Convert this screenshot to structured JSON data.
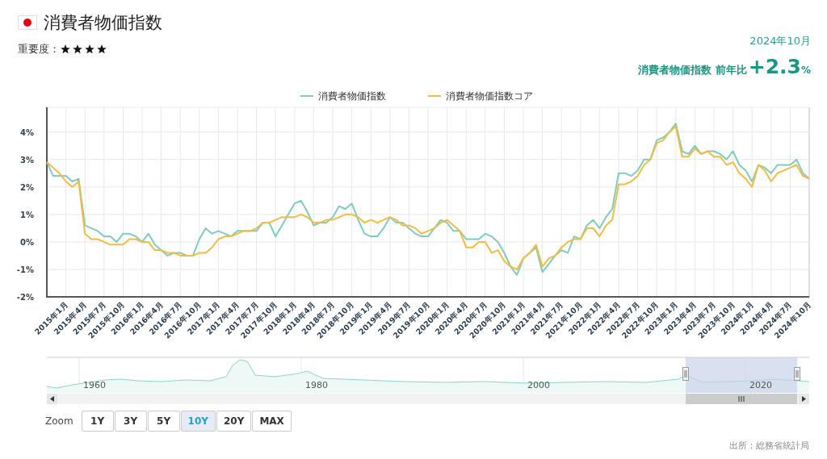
{
  "title": "消費者物価指数",
  "importance": {
    "label": "重要度：",
    "stars": 4
  },
  "latest": {
    "date": "2024年10月",
    "label": "消費者物価指数 前年比",
    "value": "+2.3",
    "unit": "%"
  },
  "chart_data": {
    "type": "line",
    "grid": true,
    "legend": true,
    "ylim": [
      -2,
      4.9
    ],
    "categories": [
      null,
      null,
      null,
      "2015年1月",
      null,
      null,
      "2015年4月",
      null,
      null,
      "2015年7月",
      null,
      null,
      "2015年10月",
      null,
      null,
      "2016年1月",
      null,
      null,
      "2016年4月",
      null,
      null,
      "2016年7月",
      null,
      null,
      "2016年10月",
      null,
      null,
      "2017年1月",
      null,
      null,
      "2017年4月",
      null,
      null,
      "2017年7月",
      null,
      null,
      "2017年10月",
      null,
      null,
      "2018年1月",
      null,
      null,
      "2018年4月",
      null,
      null,
      "2018年7月",
      null,
      null,
      "2018年10月",
      null,
      null,
      "2019年1月",
      null,
      null,
      "2019年4月",
      null,
      null,
      "2019年7月",
      null,
      null,
      "2019年10月",
      null,
      null,
      "2020年1月",
      null,
      null,
      "2020年4月",
      null,
      null,
      "2020年7月",
      null,
      null,
      "2020年10月",
      null,
      null,
      "2021年1月",
      null,
      null,
      "2021年4月",
      null,
      null,
      "2021年7月",
      null,
      null,
      "2021年10月",
      null,
      null,
      "2022年1月",
      null,
      null,
      "2022年4月",
      null,
      null,
      "2022年7月",
      null,
      null,
      "2022年10月",
      null,
      null,
      "2023年1月",
      null,
      null,
      "2023年4月",
      null,
      null,
      "2023年7月",
      null,
      null,
      "2023年10月",
      null,
      null,
      "2024年1月",
      null,
      null,
      "2024年4月",
      null,
      null,
      "2024年7月",
      null,
      null,
      "2024年10月"
    ],
    "yticks": [
      {
        "value": -2,
        "label": "-2%"
      },
      {
        "value": -1,
        "label": "-1%"
      },
      {
        "value": 0,
        "label": "0%"
      },
      {
        "value": 1,
        "label": "1%"
      },
      {
        "value": 2,
        "label": "2%"
      },
      {
        "value": 3,
        "label": "3%"
      },
      {
        "value": 4,
        "label": "4%"
      }
    ],
    "series": [
      {
        "name": "消費者物価指数",
        "color": "#7ccdbf",
        "values": [
          2.9,
          2.4,
          2.4,
          2.4,
          2.2,
          2.3,
          0.6,
          0.5,
          0.4,
          0.2,
          0.2,
          0.0,
          0.3,
          0.3,
          0.2,
          0.0,
          0.3,
          -0.1,
          -0.3,
          -0.5,
          -0.4,
          -0.4,
          -0.5,
          -0.5,
          0.1,
          0.5,
          0.3,
          0.4,
          0.3,
          0.2,
          0.4,
          0.4,
          0.4,
          0.4,
          0.7,
          0.7,
          0.2,
          0.6,
          1.0,
          1.4,
          1.5,
          1.1,
          0.6,
          0.7,
          0.7,
          0.9,
          1.3,
          1.2,
          1.4,
          0.8,
          0.3,
          0.2,
          0.2,
          0.5,
          0.9,
          0.7,
          0.7,
          0.5,
          0.3,
          0.2,
          0.2,
          0.5,
          0.8,
          0.7,
          0.4,
          0.4,
          0.1,
          0.1,
          0.1,
          0.3,
          0.2,
          0.0,
          -0.4,
          -0.9,
          -1.2,
          -0.6,
          -0.4,
          -0.2,
          -1.1,
          -0.8,
          -0.5,
          -0.3,
          -0.4,
          0.2,
          0.1,
          0.6,
          0.8,
          0.5,
          0.9,
          1.2,
          2.5,
          2.5,
          2.4,
          2.6,
          3.0,
          3.0,
          3.7,
          3.8,
          4.0,
          4.3,
          3.3,
          3.2,
          3.5,
          3.2,
          3.3,
          3.3,
          3.2,
          3.0,
          3.3,
          2.8,
          2.6,
          2.2,
          2.8,
          2.7,
          2.5,
          2.8,
          2.8,
          2.8,
          3.0,
          2.5,
          2.3
        ]
      },
      {
        "name": "消費者物価指数コア",
        "color": "#f4bc3e",
        "values": [
          2.9,
          2.7,
          2.5,
          2.2,
          2.0,
          2.2,
          0.3,
          0.1,
          0.1,
          0.0,
          -0.1,
          -0.1,
          -0.1,
          0.1,
          0.1,
          0.0,
          0.0,
          -0.3,
          -0.3,
          -0.4,
          -0.4,
          -0.5,
          -0.5,
          -0.5,
          -0.4,
          -0.4,
          -0.2,
          0.1,
          0.2,
          0.2,
          0.3,
          0.4,
          0.4,
          0.5,
          0.7,
          0.7,
          0.8,
          0.9,
          0.9,
          0.9,
          1.0,
          0.9,
          0.7,
          0.7,
          0.8,
          0.8,
          0.9,
          1.0,
          1.0,
          0.9,
          0.7,
          0.8,
          0.7,
          0.8,
          0.9,
          0.8,
          0.6,
          0.6,
          0.5,
          0.3,
          0.4,
          0.5,
          0.7,
          0.8,
          0.6,
          0.4,
          -0.2,
          -0.2,
          0.0,
          0.0,
          -0.4,
          -0.3,
          -0.7,
          -0.9,
          -1.0,
          -0.6,
          -0.4,
          -0.1,
          -0.9,
          -0.6,
          -0.5,
          -0.2,
          0.0,
          0.1,
          0.1,
          0.5,
          0.5,
          0.2,
          0.6,
          0.8,
          2.1,
          2.1,
          2.2,
          2.4,
          2.8,
          3.0,
          3.6,
          3.7,
          4.0,
          4.2,
          3.1,
          3.1,
          3.4,
          3.2,
          3.3,
          3.1,
          3.1,
          2.8,
          2.9,
          2.5,
          2.3,
          2.0,
          2.8,
          2.6,
          2.2,
          2.5,
          2.6,
          2.7,
          2.8,
          2.4,
          2.3
        ]
      }
    ]
  },
  "navigator": {
    "labels": [
      "1960",
      "1980",
      "2000",
      "2020"
    ]
  },
  "zoom": {
    "label": "Zoom",
    "buttons": [
      {
        "label": "1Y",
        "selected": false
      },
      {
        "label": "3Y",
        "selected": false
      },
      {
        "label": "5Y",
        "selected": false
      },
      {
        "label": "10Y",
        "selected": true
      },
      {
        "label": "20Y",
        "selected": false
      },
      {
        "label": "MAX",
        "selected": false
      }
    ]
  },
  "source": "出所：総務省統計局"
}
